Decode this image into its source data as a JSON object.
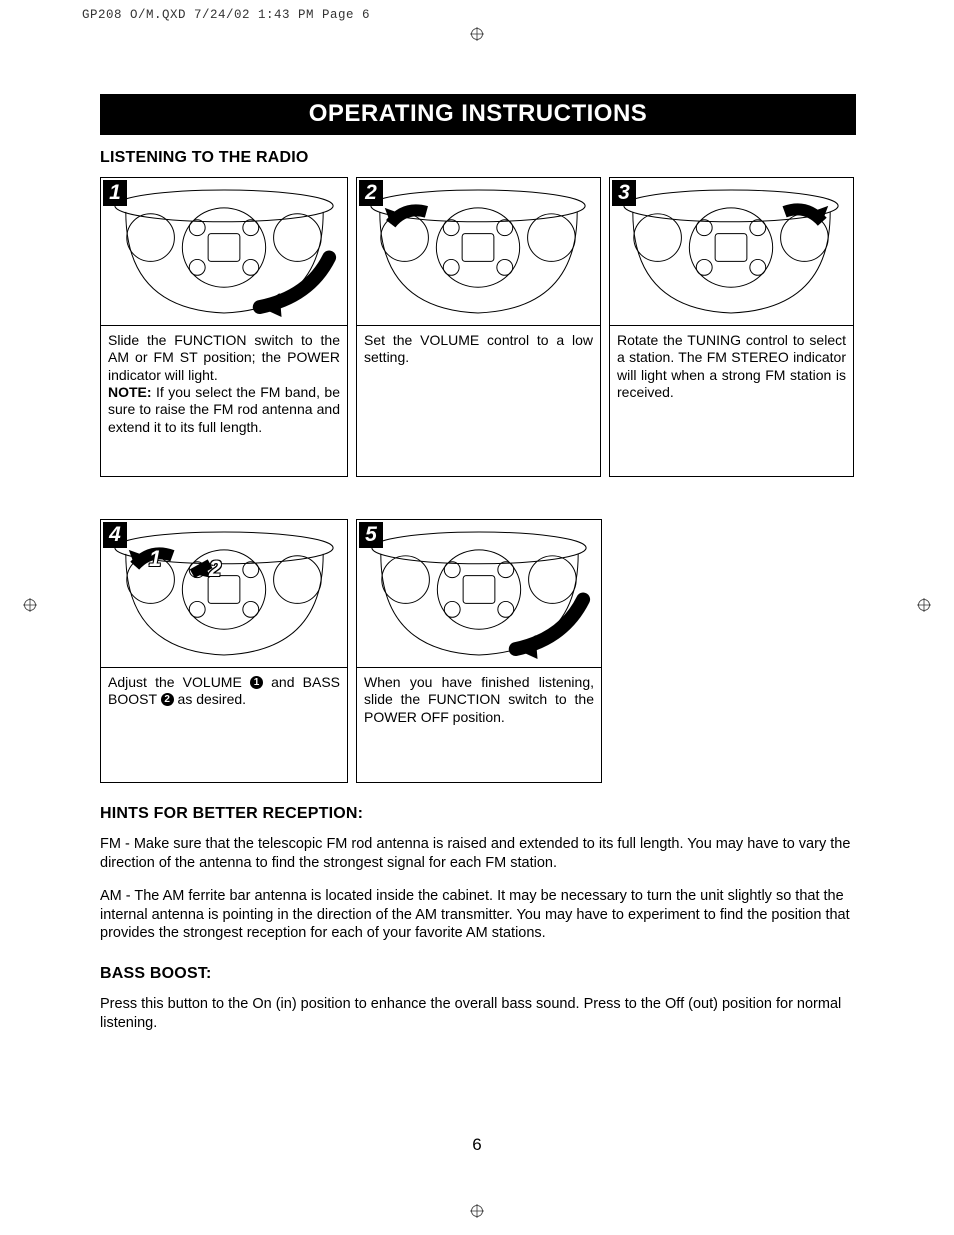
{
  "print_header": "GP208 O/M.QXD  7/24/02  1:43 PM  Page 6",
  "title": "OPERATING INSTRUCTIONS",
  "section1_heading": "LISTENING TO THE RADIO",
  "steps": {
    "s1": {
      "num": "1",
      "text_before_note": "Slide the FUNCTION switch to the AM or FM ST position; the POWER indicator will light.",
      "note_label": "NOTE:",
      "note_text": " If you select the FM band, be sure to raise the FM rod antenna and extend it to its full length."
    },
    "s2": {
      "num": "2",
      "text": "Set the VOLUME control to a low setting."
    },
    "s3": {
      "num": "3",
      "text": "Rotate the TUNING control to select a station. The FM STEREO indicator will light when a strong FM station is received."
    },
    "s4": {
      "num": "4",
      "callout1": "1",
      "callout2": "2",
      "text_a": "Adjust the VOLUME ",
      "text_b": " and BASS BOOST ",
      "text_c": " as desired."
    },
    "s5": {
      "num": "5",
      "text": "When you have finished listening, slide the FUNCTION switch to the POWER OFF position."
    }
  },
  "hints_heading": "HINTS FOR BETTER RECEPTION:",
  "hints_fm": "FM - Make sure that the telescopic FM rod antenna is raised and extended to its full length. You may have to vary the direction of the antenna to find the strongest signal for each FM station.",
  "hints_am": "AM - The AM ferrite bar antenna is located inside the cabinet. It may be necessary to turn the unit slightly so that the internal antenna is pointing in the direction of the AM transmitter. You may have to experiment to find the position that provides the strongest reception for each of your favorite AM stations.",
  "bass_heading": "BASS BOOST:",
  "bass_text": "Press this button to the On (in) position to enhance the overall bass sound. Press to the Off (out) position for normal listening.",
  "page_number": "6"
}
